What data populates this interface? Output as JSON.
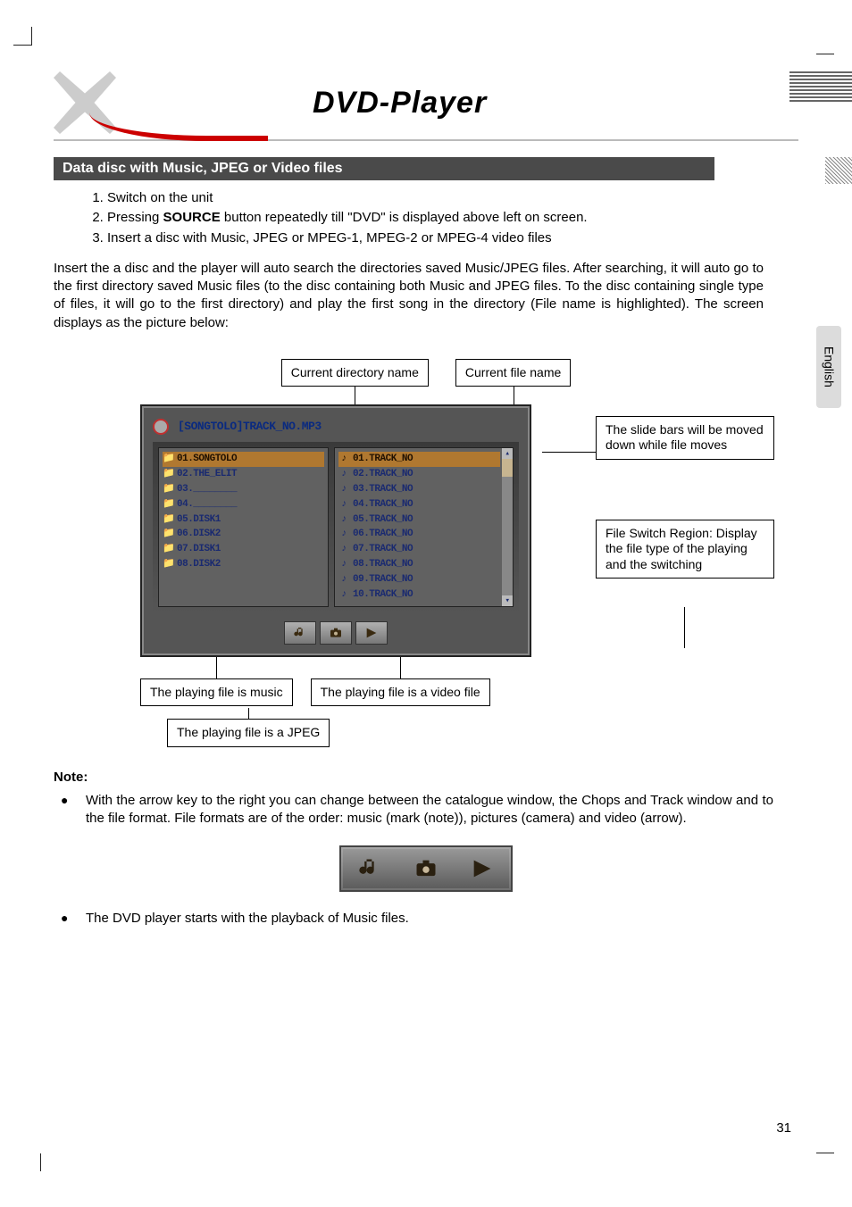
{
  "header": {
    "title": "DVD-Player"
  },
  "section": {
    "title": "Data disc with Music, JPEG or Video files"
  },
  "steps": [
    "Switch on the unit",
    "Pressing SOURCE button repeatedly till \"DVD\" is displayed above left on screen.",
    "Insert a disc with Music, JPEG or MPEG-1, MPEG-2 or MPEG-4 video files"
  ],
  "step_source_word": "SOURCE",
  "paragraph_intro": "Insert the a disc and the player will auto search the directories saved Music/JPEG files. After searching, it will auto go to the first directory saved Music files (to the disc containing both Music and JPEG files. To the disc containing single type of files, it will go to the first directory) and play the first song in the directory (File name is highlighted). The screen displays as the picture below:",
  "side_tab": "English",
  "figure": {
    "label_current_dir": "Current directory name",
    "label_current_file": "Current file name",
    "label_slide_bars": "The slide bars will be moved down while file moves",
    "label_file_switch": "File Switch Region: Display the file type of the playing and the switching",
    "label_playing_music": "The playing file is music",
    "label_playing_video": "The playing file is a video file",
    "label_playing_jpeg": "The playing file is a JPEG",
    "title_bar": "[SONGTOLO]TRACK_NO.MP3",
    "dirs": [
      "01.SONGTOLO",
      "02.THE_ELIT",
      "03.________",
      "04.________",
      "05.DISK1",
      "06.DISK2",
      "07.DISK1",
      "08.DISK2"
    ],
    "files": [
      "01.TRACK_NO",
      "02.TRACK_NO",
      "03.TRACK_NO",
      "04.TRACK_NO",
      "05.TRACK_NO",
      "06.TRACK_NO",
      "07.TRACK_NO",
      "08.TRACK_NO",
      "09.TRACK_NO",
      "10.TRACK_NO"
    ],
    "icon_names": {
      "music": "music-icon",
      "photo": "camera-icon",
      "video": "arrow-icon"
    }
  },
  "notes": {
    "title": "Note:",
    "bullet1": "With the arrow key to the right you can change between the catalogue window, the Chops and Track window and to the file format. File formats are of the order: music (mark (note)), pictures (camera) and video (arrow).",
    "bullet2": "The DVD player starts with the playback of Music files."
  },
  "page_number": "31"
}
